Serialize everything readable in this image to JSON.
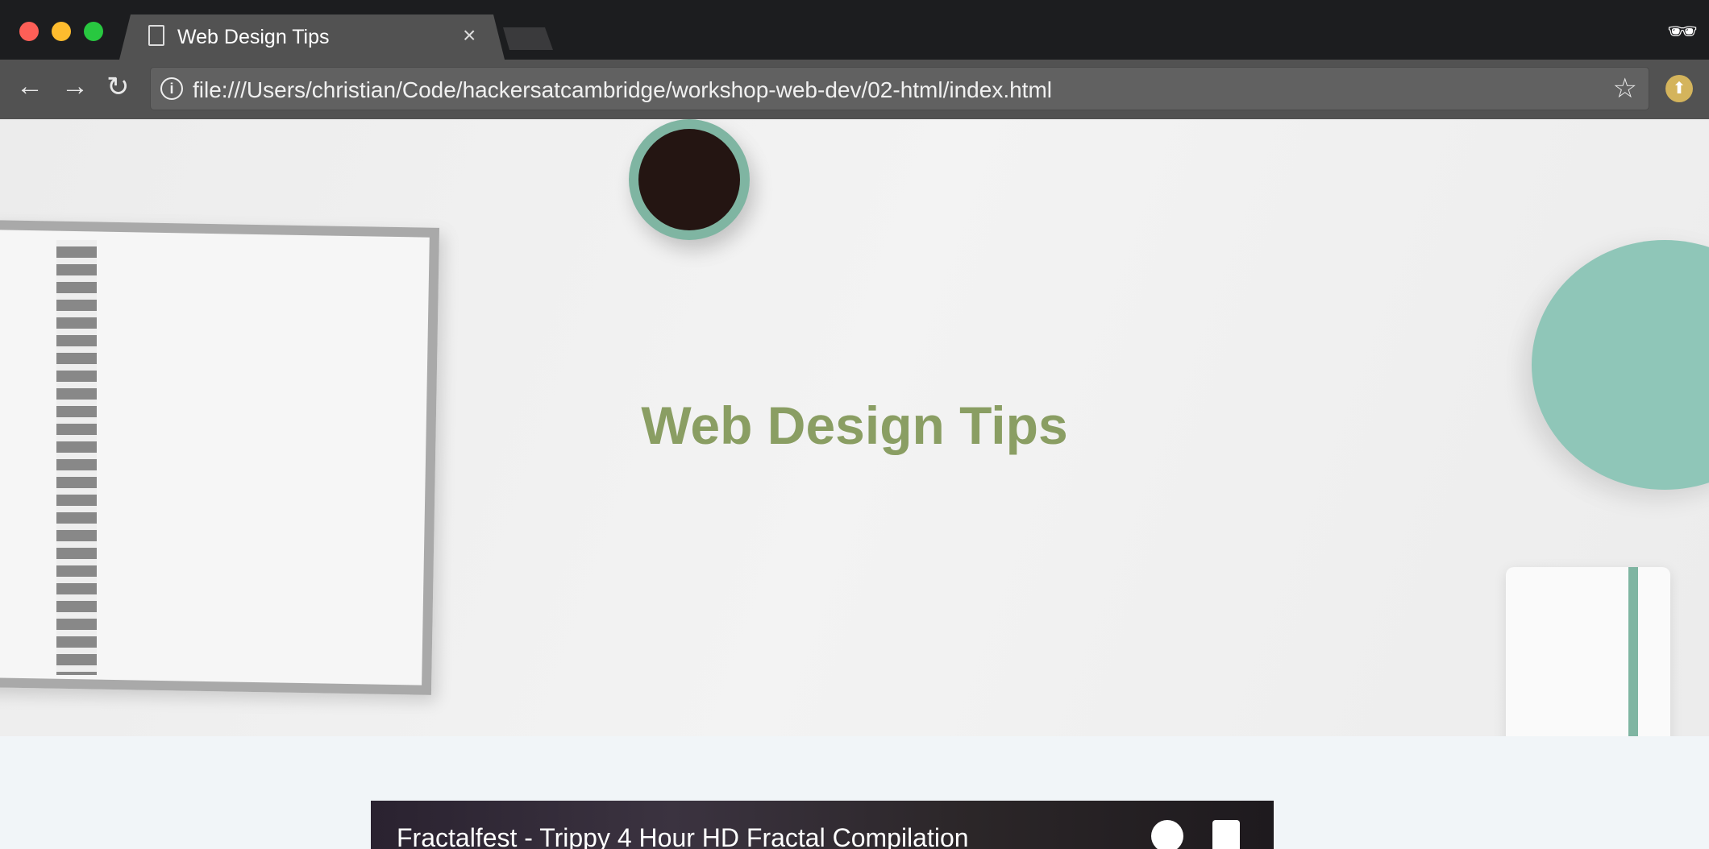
{
  "browser": {
    "tab_title": "Web Design Tips",
    "url": "file:///Users/christian/Code/hackersatcambridge/workshop-web-dev/02-html/index.html",
    "colors": {
      "close": "#fe5f57",
      "minimize": "#febc2e",
      "maximize": "#28c840"
    }
  },
  "page": {
    "hero_title": "Web Design Tips",
    "title_color": "#8a9e63",
    "video_title": "Fractalfest - Trippy 4 Hour HD Fractal Compilation"
  }
}
